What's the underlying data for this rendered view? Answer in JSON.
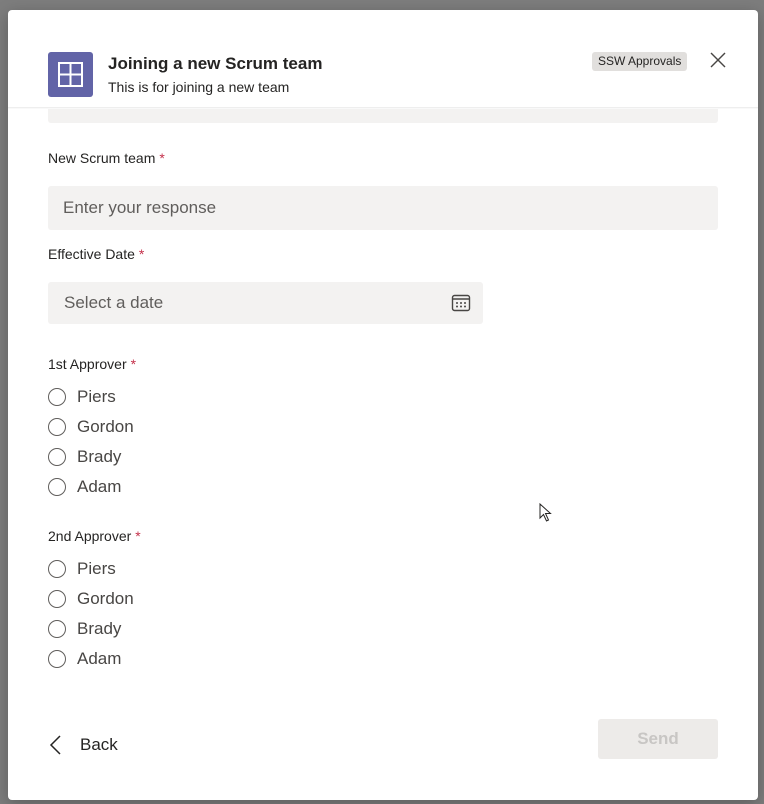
{
  "dialog": {
    "title": "Joining a new Scrum team",
    "subtitle": "This is for joining a new team",
    "badge": "SSW Approvals"
  },
  "form": {
    "new_scrum_team": {
      "label": "New Scrum team",
      "required_mark": "*",
      "placeholder": "Enter your response"
    },
    "effective_date": {
      "label": "Effective Date",
      "required_mark": "*",
      "placeholder": "Select a date"
    },
    "approver1": {
      "label": "1st Approver",
      "required_mark": "*",
      "options": [
        "Piers",
        "Gordon",
        "Brady",
        "Adam"
      ]
    },
    "approver2": {
      "label": "2nd Approver",
      "required_mark": "*",
      "options": [
        "Piers",
        "Gordon",
        "Brady",
        "Adam"
      ]
    }
  },
  "footer": {
    "back_label": "Back",
    "send_label": "Send"
  },
  "colors": {
    "brand": "#6264a7",
    "required": "#c4314b",
    "input_bg": "#f3f2f1"
  },
  "icons": [
    "app-logo-icon",
    "close-icon",
    "calendar-icon",
    "chevron-left-icon",
    "mouse-cursor-icon"
  ]
}
